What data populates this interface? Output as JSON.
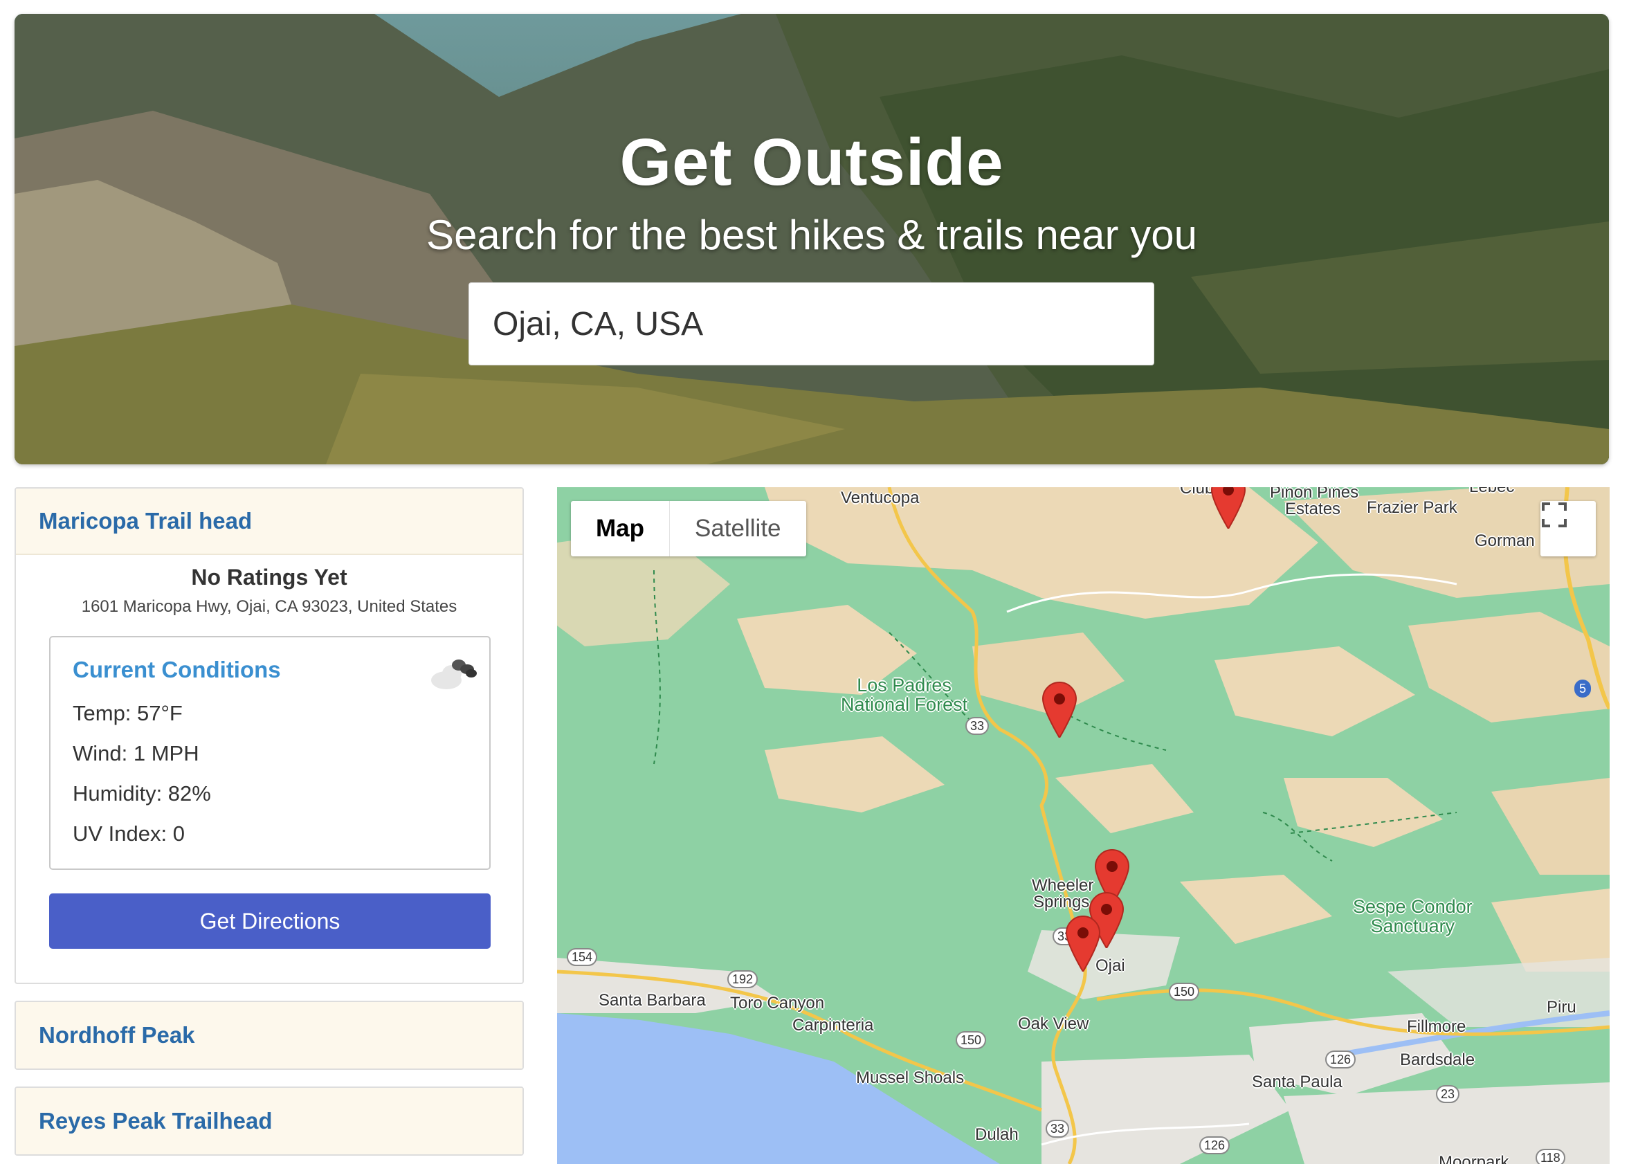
{
  "hero": {
    "title": "Get Outside",
    "subtitle": "Search for the best hikes & trails near you",
    "search_value": "Ojai, CA, USA"
  },
  "trails": [
    {
      "name": "Maricopa Trail head",
      "expanded": true,
      "ratings": "No Ratings Yet",
      "address": "1601 Maricopa Hwy, Ojai, CA 93023, United States",
      "conditions": {
        "title": "Current Conditions",
        "icon": "cloud-icon",
        "temp": "Temp: 57°F",
        "wind": "Wind: 1 MPH",
        "humidity": "Humidity: 82%",
        "uv": "UV Index: 0"
      },
      "directions_label": "Get Directions"
    },
    {
      "name": "Nordhoff Peak",
      "expanded": false
    },
    {
      "name": "Reyes Peak Trailhead",
      "expanded": false
    }
  ],
  "map": {
    "type_buttons": [
      "Map",
      "Satellite"
    ],
    "active_type": "Map",
    "labels": {
      "ventucopa": "Ventucopa",
      "club": "Club",
      "pinon": "Pinon Pines",
      "estates": "Estates",
      "frazier": "Frazier Park",
      "lebec": "Lebec",
      "gorman": "Gorman",
      "lospadres": "Los Padres",
      "nationalforest": "National Forest",
      "wheeler": "Wheeler",
      "springs": "Springs",
      "ojai": "Ojai",
      "sespe1": "Sespe Condor",
      "sespe2": "Sanctuary",
      "santabarbara": "Santa Barbara",
      "toro": "Toro Canyon",
      "carpinteria": "Carpinteria",
      "oakview": "Oak View",
      "piru": "Piru",
      "fillmore": "Fillmore",
      "bardsdale": "Bardsdale",
      "santapaula": "Santa Paula",
      "mussel": "Mussel Shoals",
      "dulah": "Dulah",
      "moorpark": "Moorpark"
    },
    "shields": {
      "s33a": "33",
      "s33b": "33",
      "s33c": "33",
      "s154": "154",
      "s192": "192",
      "s150a": "150",
      "s150b": "150",
      "s126a": "126",
      "s126b": "126",
      "s23": "23",
      "s5": "5",
      "s118": "118"
    }
  }
}
